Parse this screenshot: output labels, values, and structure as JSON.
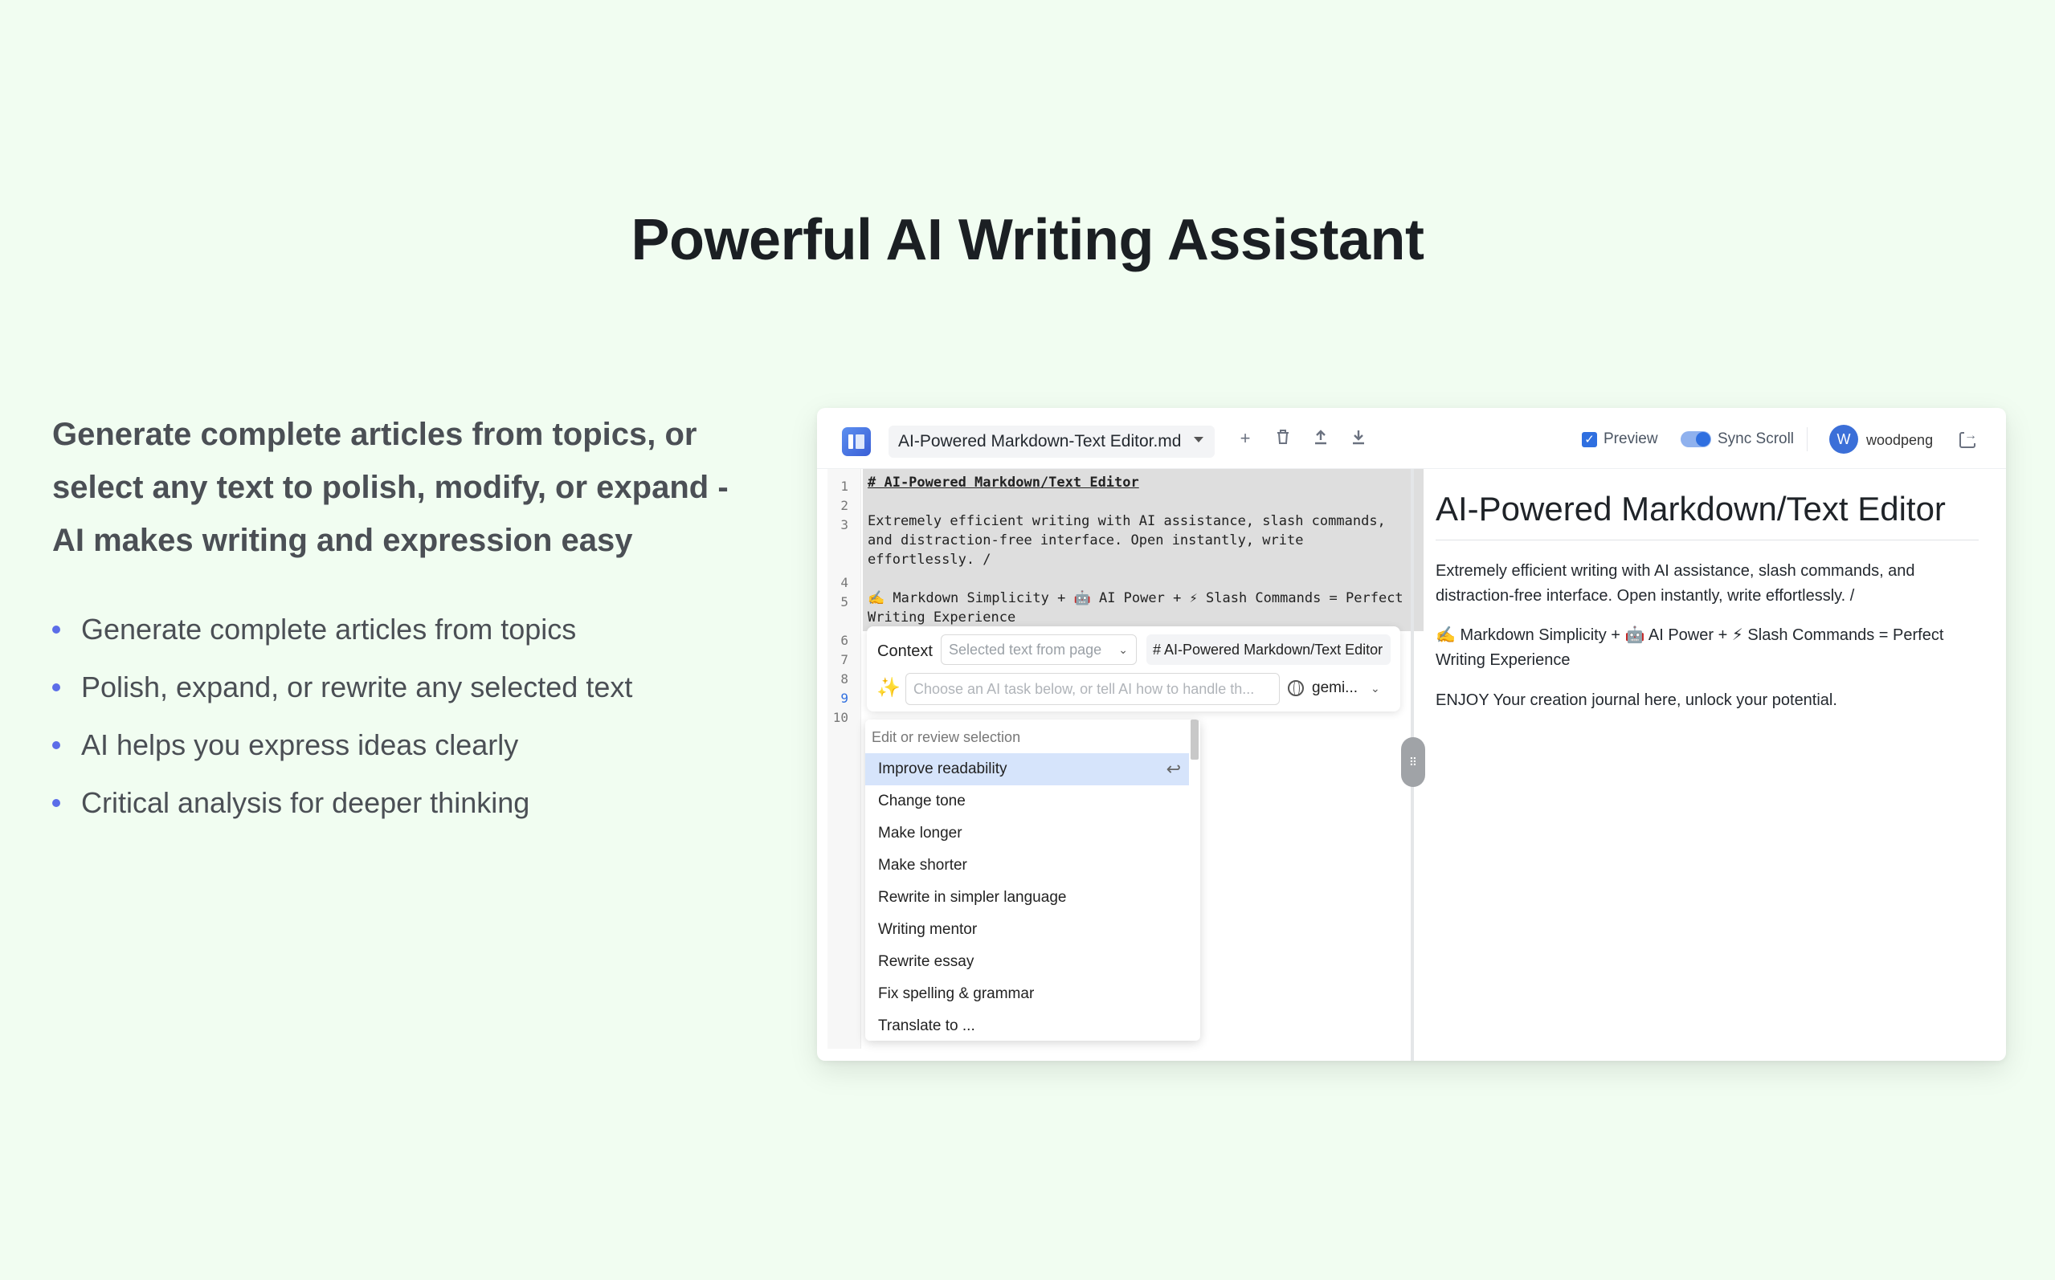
{
  "hero": {
    "title": "Powerful AI Writing Assistant",
    "intro": "Generate complete articles from topics, or select any text to polish, modify, or expand - AI makes writing and expression easy",
    "features": [
      "Generate complete articles from topics",
      "Polish, expand, or rewrite any selected text",
      "AI helps you express ideas clearly",
      "Critical analysis for deeper thinking"
    ]
  },
  "toolbar": {
    "file_name": "AI-Powered Markdown-Text Editor.md",
    "preview_label": "Preview",
    "preview_checked": true,
    "sync_label": "Sync Scroll",
    "sync_on": true,
    "avatar_initial": "W",
    "username": "woodpeng",
    "icons": [
      "plus-icon",
      "trash-icon",
      "upload-icon",
      "download-icon",
      "logout-icon"
    ]
  },
  "editor": {
    "line_numbers": [
      "1",
      "2",
      "3",
      "4",
      "5",
      "6",
      "7",
      "8",
      "9",
      "10"
    ],
    "active_line": "9",
    "lines": {
      "l1": "# AI-Powered Markdown/Text Editor",
      "l3a": "Extremely efficient writing with AI assistance, slash commands,",
      "l3b": "and distraction-free interface. Open instantly, write",
      "l3c": "effortlessly. /",
      "l5a": "✍️ Markdown Simplicity + 🤖 AI Power + ⚡ Slash Commands = Perfect",
      "l5b": "Writing Experience"
    }
  },
  "ai_panel": {
    "context_label": "Context",
    "context_select": "Selected text from page",
    "context_text": "# AI-Powered Markdown/Text Editor",
    "task_placeholder": "Choose an AI task below, or tell AI how to handle th...",
    "model": "gemi...",
    "menu_header": "Edit or review selection",
    "menu_items": [
      "Improve readability",
      "Change tone",
      "Make longer",
      "Make shorter",
      "Rewrite in simpler language",
      "Writing mentor",
      "Rewrite essay",
      "Fix spelling & grammar",
      "Translate to ..."
    ],
    "highlighted_item": "Improve readability",
    "enter_glyph": "↩"
  },
  "preview": {
    "title": "AI-Powered Markdown/Text Editor",
    "p1": "Extremely efficient writing with AI assistance, slash commands, and distraction-free interface. Open instantly, write effortlessly. /",
    "p2": "✍️ Markdown Simplicity + 🤖 AI Power + ⚡ Slash Commands = Perfect Writing Experience",
    "p3": "ENJOY Your creation journal here, unlock your potential."
  },
  "colors": {
    "background": "#f1fdf1",
    "accent": "#2f6fe0",
    "bullet": "#5b6de8",
    "menu_highlight": "#d6e4fb"
  }
}
